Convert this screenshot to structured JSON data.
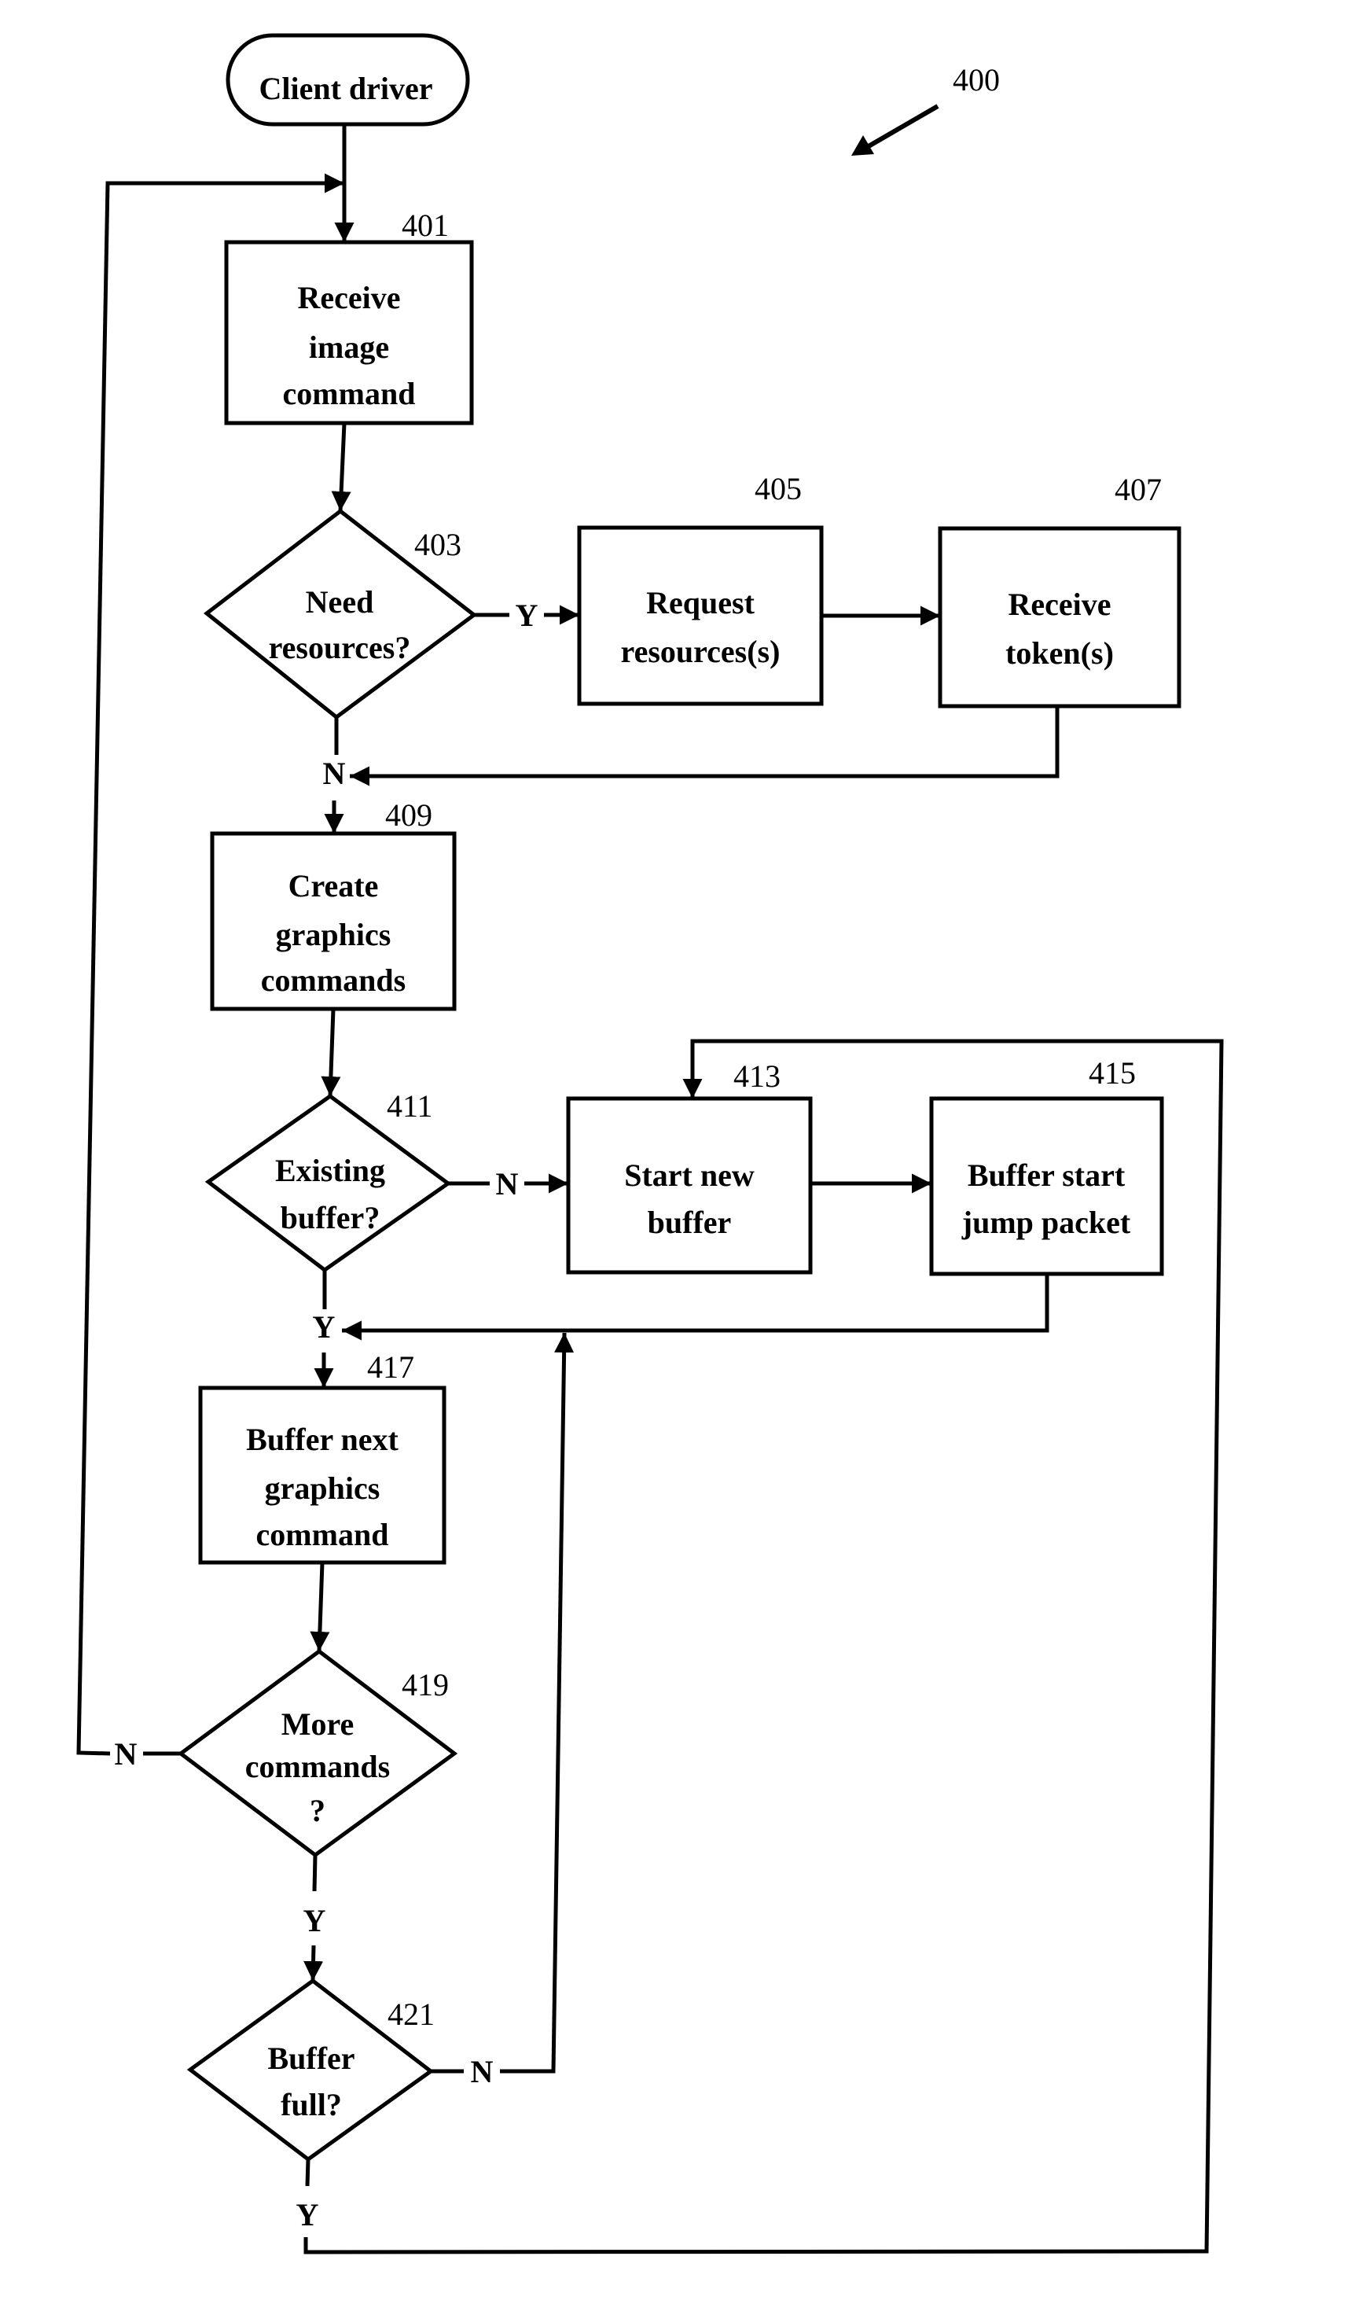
{
  "figure": {
    "reference_number": "400",
    "nodes": [
      {
        "id": "start",
        "ref": "",
        "type": "terminal",
        "lines": [
          "Client driver"
        ]
      },
      {
        "id": "401",
        "ref": "401",
        "type": "process",
        "lines": [
          "Receive",
          "image",
          "command"
        ]
      },
      {
        "id": "403",
        "ref": "403",
        "type": "decision",
        "lines": [
          "Need",
          "resources?"
        ]
      },
      {
        "id": "405",
        "ref": "405",
        "type": "process",
        "lines": [
          "Request",
          "resources(s)"
        ]
      },
      {
        "id": "407",
        "ref": "407",
        "type": "process",
        "lines": [
          "Receive",
          "token(s)"
        ]
      },
      {
        "id": "409",
        "ref": "409",
        "type": "process",
        "lines": [
          "Create",
          "graphics",
          "commands"
        ]
      },
      {
        "id": "411",
        "ref": "411",
        "type": "decision",
        "lines": [
          "Existing",
          "buffer?"
        ]
      },
      {
        "id": "413",
        "ref": "413",
        "type": "process",
        "lines": [
          "Start new",
          "buffer"
        ]
      },
      {
        "id": "415",
        "ref": "415",
        "type": "process",
        "lines": [
          "Buffer start",
          "jump packet"
        ]
      },
      {
        "id": "417",
        "ref": "417",
        "type": "process",
        "lines": [
          "Buffer next",
          "graphics",
          "command"
        ]
      },
      {
        "id": "419",
        "ref": "419",
        "type": "decision",
        "lines": [
          "More",
          "commands",
          "?"
        ]
      },
      {
        "id": "421",
        "ref": "421",
        "type": "decision",
        "lines": [
          "Buffer",
          "full?"
        ]
      }
    ],
    "edges": [
      {
        "id": "e-start-401",
        "from": "start",
        "to": "401",
        "label": ""
      },
      {
        "id": "e-401-403",
        "from": "401",
        "to": "403",
        "label": ""
      },
      {
        "id": "e-403-405",
        "from": "403",
        "to": "405",
        "label": "Y"
      },
      {
        "id": "e-405-407",
        "from": "405",
        "to": "407",
        "label": ""
      },
      {
        "id": "e-407-409",
        "from": "407",
        "to": "409",
        "label": ""
      },
      {
        "id": "e-403-409",
        "from": "403",
        "to": "409",
        "label": "N"
      },
      {
        "id": "e-409-411",
        "from": "409",
        "to": "411",
        "label": ""
      },
      {
        "id": "e-411-413",
        "from": "411",
        "to": "413",
        "label": "N"
      },
      {
        "id": "e-413-415",
        "from": "413",
        "to": "415",
        "label": ""
      },
      {
        "id": "e-415-417",
        "from": "415",
        "to": "417",
        "label": ""
      },
      {
        "id": "e-411-417",
        "from": "411",
        "to": "417",
        "label": "Y"
      },
      {
        "id": "e-417-419",
        "from": "417",
        "to": "419",
        "label": ""
      },
      {
        "id": "e-419-401",
        "from": "419",
        "to": "401",
        "label": "N"
      },
      {
        "id": "e-419-421",
        "from": "419",
        "to": "421",
        "label": "Y"
      },
      {
        "id": "e-421-417",
        "from": "421",
        "to": "417",
        "label": "N"
      },
      {
        "id": "e-421-413",
        "from": "421",
        "to": "413",
        "label": "Y"
      }
    ]
  }
}
